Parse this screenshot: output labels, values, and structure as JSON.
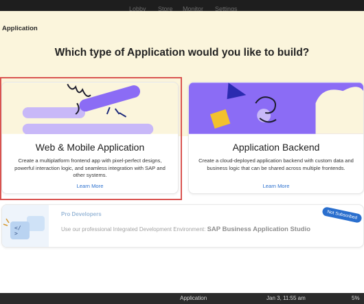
{
  "topnav": {
    "items": [
      "Lobby",
      "Store",
      "Monitor",
      "Settings"
    ]
  },
  "page": {
    "title": "Application",
    "headline": "Which type of Application would you like to build?"
  },
  "cards": [
    {
      "title": "Web & Mobile Application",
      "desc": "Create a multiplatform frontend app with pixel-perfect designs, powerful interaction logic, and seamless integration with SAP and other systems.",
      "link": "Learn More",
      "selected": true
    },
    {
      "title": "Application Backend",
      "desc": "Create a cloud-deployed application backend with custom data and business logic that can be shared across multiple frontends.",
      "link": "Learn More",
      "selected": false
    }
  ],
  "pro": {
    "title": "Pro Developers",
    "desc_prefix": "Use our professional Integrated Development Environment:",
    "product": "SAP Business Application Studio",
    "badge": "Not Subscribed"
  },
  "taskbar": {
    "app": "Application",
    "datetime": "Jan 3, 11:55 am",
    "extra": "5%"
  },
  "colors": {
    "accent": "#2a6fce",
    "hero_bg": "#fbf5dc",
    "purple": "#8b6cf5",
    "selection": "#d9534f"
  }
}
